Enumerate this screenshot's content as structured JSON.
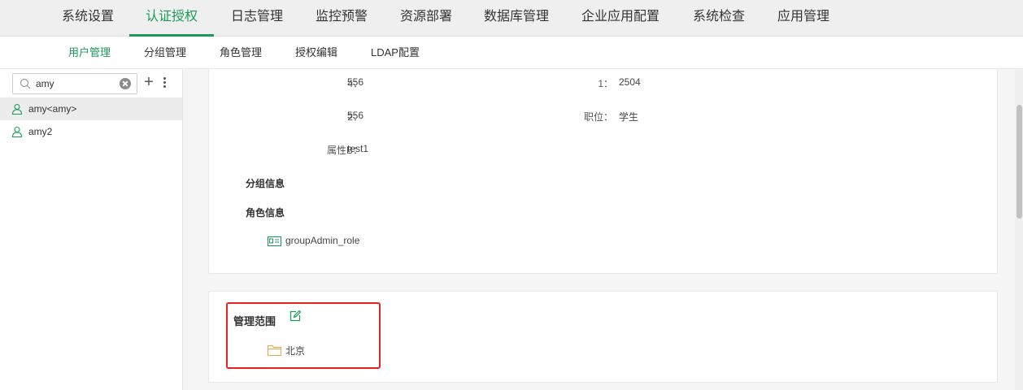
{
  "top_nav": {
    "tabs": [
      {
        "label": "系统设置"
      },
      {
        "label": "认证授权"
      },
      {
        "label": "日志管理"
      },
      {
        "label": "监控预警"
      },
      {
        "label": "资源部署"
      },
      {
        "label": "数据库管理"
      },
      {
        "label": "企业应用配置"
      },
      {
        "label": "系统检查"
      },
      {
        "label": "应用管理"
      }
    ],
    "active": "认证授权"
  },
  "sub_nav": {
    "tabs": [
      {
        "label": "用户管理"
      },
      {
        "label": "分组管理"
      },
      {
        "label": "角色管理"
      },
      {
        "label": "授权编辑"
      },
      {
        "label": "LDAP配置"
      }
    ],
    "active": "用户管理"
  },
  "sidebar": {
    "search": {
      "value": "amy",
      "icon": "search-icon"
    },
    "users": [
      {
        "label": "amy<amy>",
        "selected": true
      },
      {
        "label": "amy2",
        "selected": false
      }
    ]
  },
  "user_detail": {
    "fields": [
      {
        "label": "4：",
        "value": "556"
      },
      {
        "label": "1：",
        "value": "2504"
      },
      {
        "label": "2：",
        "value": "556"
      },
      {
        "label": "职位：",
        "value": "学生"
      },
      {
        "label": "属性B：",
        "value": "test1"
      }
    ],
    "group_section": "分组信息",
    "role_section": "角色信息",
    "roles": [
      {
        "label": "groupAdmin_role"
      }
    ]
  },
  "scope": {
    "title": "管理范围",
    "items": [
      {
        "label": "北京"
      }
    ]
  },
  "colors": {
    "accent": "#1a9b5a",
    "highlight": "#e8231f",
    "folder": "#f0a64a"
  }
}
